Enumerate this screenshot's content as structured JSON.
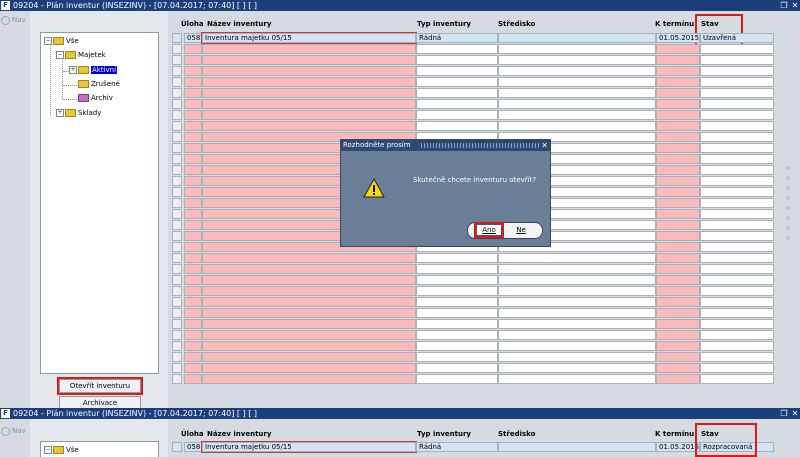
{
  "window": {
    "title": "09204 - Plán inventur (INSEZINV) - [07.04.2017; 07:40]  [ ]  [ ]",
    "nav_label": "Nav"
  },
  "tree": [
    {
      "label": "Vše",
      "selected": false
    },
    {
      "label": "Majetek",
      "selected": false
    },
    {
      "label": "Aktivní",
      "selected": true
    },
    {
      "label": "Zrušené",
      "selected": false
    },
    {
      "label": "Archiv",
      "selected": false
    },
    {
      "label": "Sklady",
      "selected": false
    }
  ],
  "buttons": {
    "open": "Otevřít inventuru",
    "archive": "Archivace"
  },
  "table": {
    "columns": [
      "Úloha",
      "Název inventury",
      "Typ inventury",
      "Středisko",
      "K termínu",
      "Stav"
    ],
    "row_top": {
      "uloha": "058",
      "nazev": "Inventura majetku 05/15",
      "typ": "Řádná",
      "stredisko": "",
      "k_terminu": "01.05.2015",
      "stav": "Uzavřená"
    },
    "row_bottom": {
      "uloha": "058",
      "nazev": "Inventura majetku 05/15",
      "typ": "Řádná",
      "stredisko": "",
      "k_terminu": "01.05.2015",
      "stav": "Rozpracovaná"
    }
  },
  "dialog": {
    "title": "Rozhodněte prosím",
    "message": "Skutečně chcete inventuru otevřít?",
    "yes": "Ano",
    "no": "Ne"
  },
  "bottom_tree": {
    "label": "Vše"
  },
  "colors": {
    "highlight": "#e01818",
    "pink_cell": "#fbb9b9",
    "title_bar": "#1b3f7b",
    "dialog_bg": "#6b7e98"
  }
}
